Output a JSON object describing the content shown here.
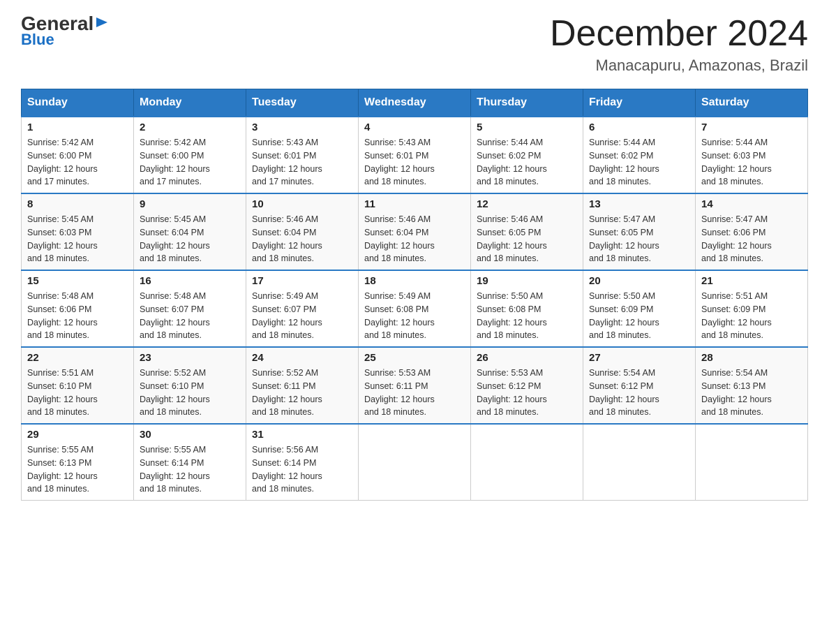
{
  "header": {
    "logo_general": "General",
    "logo_blue": "Blue",
    "month_title": "December 2024",
    "location": "Manacapuru, Amazonas, Brazil"
  },
  "days_of_week": [
    "Sunday",
    "Monday",
    "Tuesday",
    "Wednesday",
    "Thursday",
    "Friday",
    "Saturday"
  ],
  "weeks": [
    [
      {
        "day": "1",
        "sunrise": "5:42 AM",
        "sunset": "6:00 PM",
        "daylight": "12 hours and 17 minutes."
      },
      {
        "day": "2",
        "sunrise": "5:42 AM",
        "sunset": "6:00 PM",
        "daylight": "12 hours and 17 minutes."
      },
      {
        "day": "3",
        "sunrise": "5:43 AM",
        "sunset": "6:01 PM",
        "daylight": "12 hours and 17 minutes."
      },
      {
        "day": "4",
        "sunrise": "5:43 AM",
        "sunset": "6:01 PM",
        "daylight": "12 hours and 18 minutes."
      },
      {
        "day": "5",
        "sunrise": "5:44 AM",
        "sunset": "6:02 PM",
        "daylight": "12 hours and 18 minutes."
      },
      {
        "day": "6",
        "sunrise": "5:44 AM",
        "sunset": "6:02 PM",
        "daylight": "12 hours and 18 minutes."
      },
      {
        "day": "7",
        "sunrise": "5:44 AM",
        "sunset": "6:03 PM",
        "daylight": "12 hours and 18 minutes."
      }
    ],
    [
      {
        "day": "8",
        "sunrise": "5:45 AM",
        "sunset": "6:03 PM",
        "daylight": "12 hours and 18 minutes."
      },
      {
        "day": "9",
        "sunrise": "5:45 AM",
        "sunset": "6:04 PM",
        "daylight": "12 hours and 18 minutes."
      },
      {
        "day": "10",
        "sunrise": "5:46 AM",
        "sunset": "6:04 PM",
        "daylight": "12 hours and 18 minutes."
      },
      {
        "day": "11",
        "sunrise": "5:46 AM",
        "sunset": "6:04 PM",
        "daylight": "12 hours and 18 minutes."
      },
      {
        "day": "12",
        "sunrise": "5:46 AM",
        "sunset": "6:05 PM",
        "daylight": "12 hours and 18 minutes."
      },
      {
        "day": "13",
        "sunrise": "5:47 AM",
        "sunset": "6:05 PM",
        "daylight": "12 hours and 18 minutes."
      },
      {
        "day": "14",
        "sunrise": "5:47 AM",
        "sunset": "6:06 PM",
        "daylight": "12 hours and 18 minutes."
      }
    ],
    [
      {
        "day": "15",
        "sunrise": "5:48 AM",
        "sunset": "6:06 PM",
        "daylight": "12 hours and 18 minutes."
      },
      {
        "day": "16",
        "sunrise": "5:48 AM",
        "sunset": "6:07 PM",
        "daylight": "12 hours and 18 minutes."
      },
      {
        "day": "17",
        "sunrise": "5:49 AM",
        "sunset": "6:07 PM",
        "daylight": "12 hours and 18 minutes."
      },
      {
        "day": "18",
        "sunrise": "5:49 AM",
        "sunset": "6:08 PM",
        "daylight": "12 hours and 18 minutes."
      },
      {
        "day": "19",
        "sunrise": "5:50 AM",
        "sunset": "6:08 PM",
        "daylight": "12 hours and 18 minutes."
      },
      {
        "day": "20",
        "sunrise": "5:50 AM",
        "sunset": "6:09 PM",
        "daylight": "12 hours and 18 minutes."
      },
      {
        "day": "21",
        "sunrise": "5:51 AM",
        "sunset": "6:09 PM",
        "daylight": "12 hours and 18 minutes."
      }
    ],
    [
      {
        "day": "22",
        "sunrise": "5:51 AM",
        "sunset": "6:10 PM",
        "daylight": "12 hours and 18 minutes."
      },
      {
        "day": "23",
        "sunrise": "5:52 AM",
        "sunset": "6:10 PM",
        "daylight": "12 hours and 18 minutes."
      },
      {
        "day": "24",
        "sunrise": "5:52 AM",
        "sunset": "6:11 PM",
        "daylight": "12 hours and 18 minutes."
      },
      {
        "day": "25",
        "sunrise": "5:53 AM",
        "sunset": "6:11 PM",
        "daylight": "12 hours and 18 minutes."
      },
      {
        "day": "26",
        "sunrise": "5:53 AM",
        "sunset": "6:12 PM",
        "daylight": "12 hours and 18 minutes."
      },
      {
        "day": "27",
        "sunrise": "5:54 AM",
        "sunset": "6:12 PM",
        "daylight": "12 hours and 18 minutes."
      },
      {
        "day": "28",
        "sunrise": "5:54 AM",
        "sunset": "6:13 PM",
        "daylight": "12 hours and 18 minutes."
      }
    ],
    [
      {
        "day": "29",
        "sunrise": "5:55 AM",
        "sunset": "6:13 PM",
        "daylight": "12 hours and 18 minutes."
      },
      {
        "day": "30",
        "sunrise": "5:55 AM",
        "sunset": "6:14 PM",
        "daylight": "12 hours and 18 minutes."
      },
      {
        "day": "31",
        "sunrise": "5:56 AM",
        "sunset": "6:14 PM",
        "daylight": "12 hours and 18 minutes."
      },
      null,
      null,
      null,
      null
    ]
  ],
  "labels": {
    "sunrise": "Sunrise:",
    "sunset": "Sunset:",
    "daylight": "Daylight:"
  }
}
